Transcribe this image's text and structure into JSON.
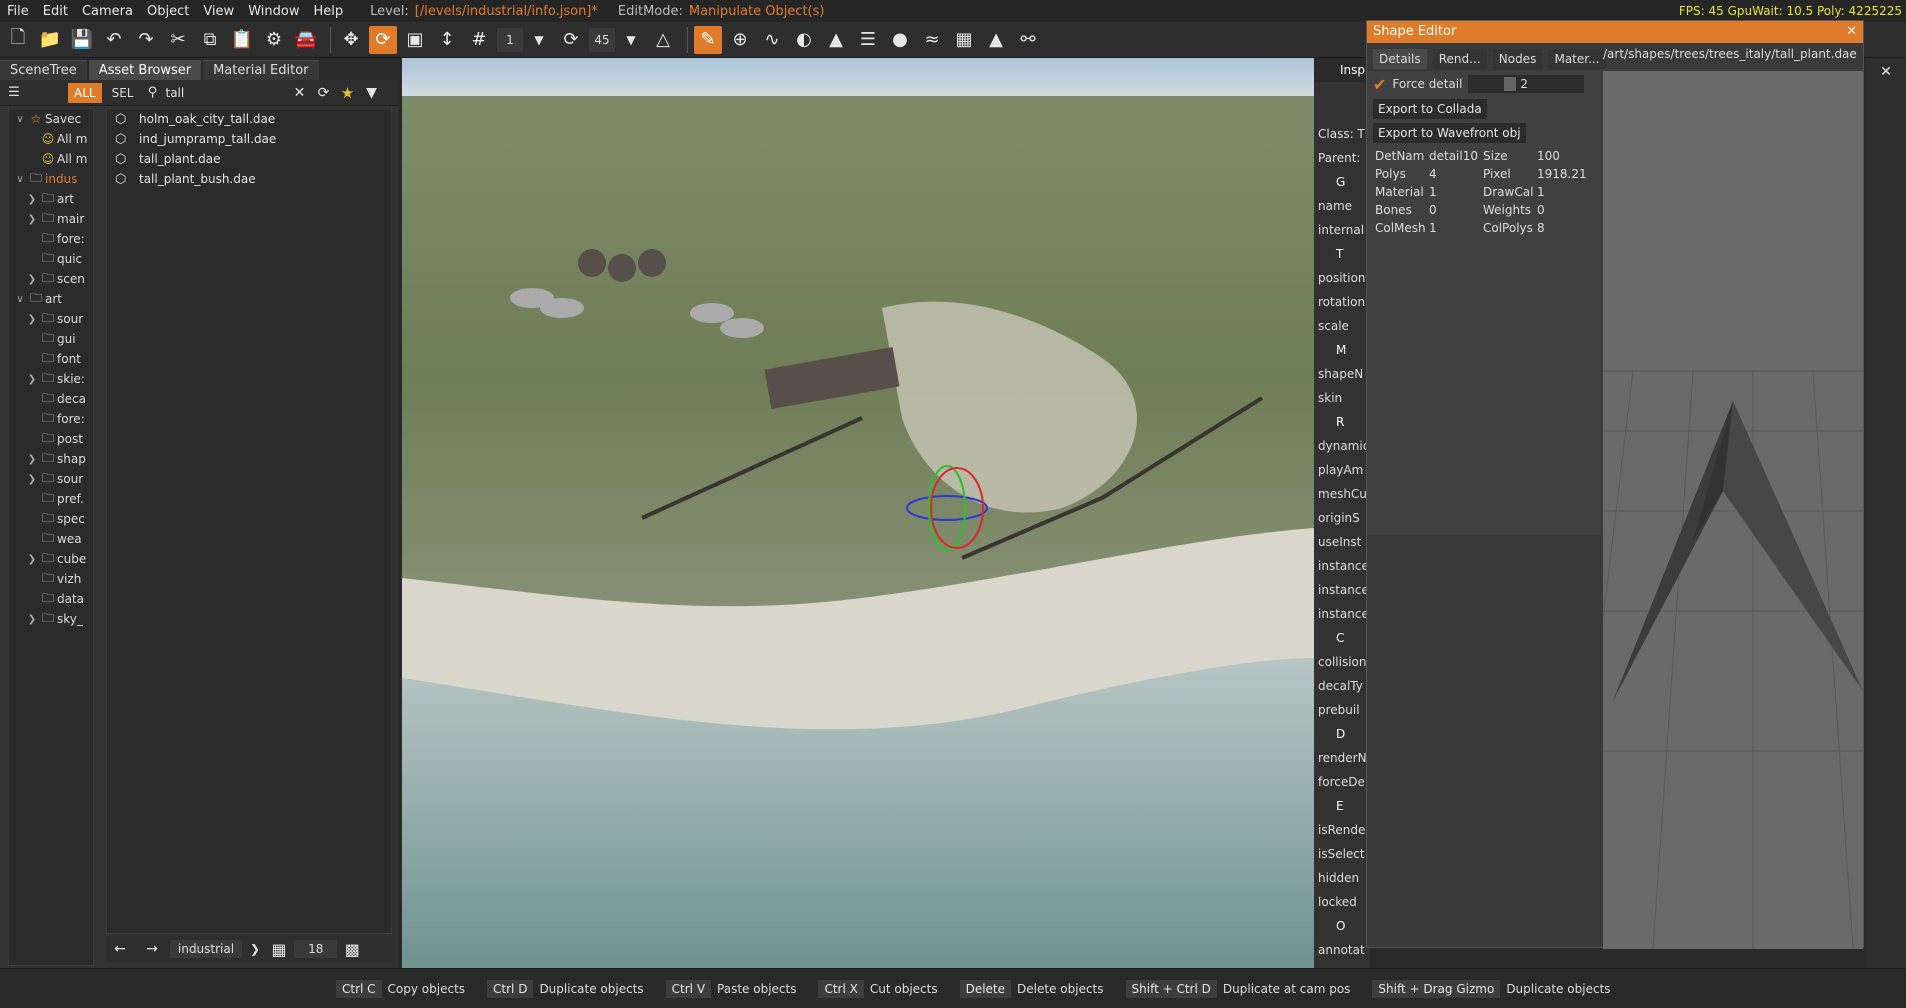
{
  "menu": {
    "items": [
      "File",
      "Edit",
      "Camera",
      "Object",
      "View",
      "Window",
      "Help"
    ],
    "level_label": "Level:",
    "level_value": "[/levels/industrial/info.json]*",
    "editmode_label": "EditMode:",
    "editmode_value": "Manipulate Object(s)",
    "perf": "FPS: 45  GpuWait: 10.5   Poly: 4225225"
  },
  "toolbar": {
    "snap_value": "1",
    "angle_value": "45"
  },
  "left_panel": {
    "tabs": [
      "SceneTree",
      "Asset Browser",
      "Material Editor"
    ],
    "filter_all": "ALL",
    "filter_sel": "SEL",
    "search_value": "tall",
    "tree": [
      {
        "label": "Savec",
        "indent": 0,
        "arrow": "v",
        "icon": "star"
      },
      {
        "label": "All m",
        "indent": 1,
        "arrow": "",
        "icon": "smile"
      },
      {
        "label": "All m",
        "indent": 1,
        "arrow": "",
        "icon": "smile"
      },
      {
        "label": "indus",
        "indent": 0,
        "arrow": "v",
        "icon": "folder",
        "hl": true
      },
      {
        "label": "art",
        "indent": 1,
        "arrow": ">",
        "icon": "folder"
      },
      {
        "label": "mair",
        "indent": 1,
        "arrow": ">",
        "icon": "folder"
      },
      {
        "label": "fore:",
        "indent": 1,
        "arrow": "",
        "icon": "folder"
      },
      {
        "label": "quic",
        "indent": 1,
        "arrow": "",
        "icon": "folder"
      },
      {
        "label": "scen",
        "indent": 1,
        "arrow": ">",
        "icon": "folder"
      },
      {
        "label": "art",
        "indent": 0,
        "arrow": "v",
        "icon": "folder"
      },
      {
        "label": "sour",
        "indent": 1,
        "arrow": ">",
        "icon": "folder"
      },
      {
        "label": "gui",
        "indent": 1,
        "arrow": "",
        "icon": "folder"
      },
      {
        "label": "font",
        "indent": 1,
        "arrow": "",
        "icon": "folder"
      },
      {
        "label": "skie:",
        "indent": 1,
        "arrow": ">",
        "icon": "folder"
      },
      {
        "label": "deca",
        "indent": 1,
        "arrow": "",
        "icon": "folder"
      },
      {
        "label": "fore:",
        "indent": 1,
        "arrow": "",
        "icon": "folder"
      },
      {
        "label": "post",
        "indent": 1,
        "arrow": "",
        "icon": "folder"
      },
      {
        "label": "shap",
        "indent": 1,
        "arrow": ">",
        "icon": "folder"
      },
      {
        "label": "sour",
        "indent": 1,
        "arrow": ">",
        "icon": "folder"
      },
      {
        "label": "pref.",
        "indent": 1,
        "arrow": "",
        "icon": "folder"
      },
      {
        "label": "spec",
        "indent": 1,
        "arrow": "",
        "icon": "folder"
      },
      {
        "label": "wea",
        "indent": 1,
        "arrow": "",
        "icon": "folder"
      },
      {
        "label": "cube",
        "indent": 1,
        "arrow": ">",
        "icon": "folder"
      },
      {
        "label": "vizh",
        "indent": 1,
        "arrow": "",
        "icon": "folder"
      },
      {
        "label": "data",
        "indent": 1,
        "arrow": "",
        "icon": "folder"
      },
      {
        "label": "sky_",
        "indent": 1,
        "arrow": ">",
        "icon": "folder"
      }
    ],
    "files": [
      "holm_oak_city_tall.dae",
      "ind_jumpramp_tall.dae",
      "tall_plant.dae",
      "tall_plant_bush.dae"
    ],
    "nav_path": "industrial",
    "nav_count": "18"
  },
  "inspector": {
    "title": "Insp",
    "rows": [
      "Class: T",
      "Parent:",
      "G",
      "name",
      "internal",
      "T",
      "position",
      "rotation",
      "scale",
      "M",
      "shapeN",
      "skin",
      "R",
      "dynamic",
      "playAm",
      "meshCu",
      "originS",
      "useInst",
      "instance",
      "instance",
      "instance",
      "C",
      "collision",
      "decalTy",
      "prebuil",
      "D",
      "renderN",
      "forceDe",
      "E",
      "isRende",
      "isSelect",
      "hidden",
      "locked",
      "O",
      "annotat"
    ],
    "headers": [
      "G",
      "T",
      "M",
      "R",
      "C",
      "D",
      "E",
      "O"
    ]
  },
  "shape_editor": {
    "title": "Shape Editor",
    "tabs": [
      "Details",
      "Rend...",
      "Nodes",
      "Mater..."
    ],
    "path": "/art/shapes/trees/trees_italy/tall_plant.dae",
    "force_detail_label": "Force detail",
    "force_detail_value": "2",
    "export_collada": "Export to Collada",
    "export_obj": "Export to Wavefront obj",
    "details": [
      [
        "DetNam",
        "detail10",
        "Size",
        "100"
      ],
      [
        "Polys",
        "4",
        "Pixel",
        "1918.21"
      ],
      [
        "Material",
        "1",
        "DrawCal",
        "1"
      ],
      [
        "Bones",
        "0",
        "Weights",
        "0"
      ],
      [
        "ColMesh",
        "1",
        "ColPolys",
        "8"
      ]
    ]
  },
  "statusbar": [
    {
      "key": "Ctrl C",
      "desc": "Copy objects"
    },
    {
      "key": "Ctrl D",
      "desc": "Duplicate objects"
    },
    {
      "key": "Ctrl V",
      "desc": "Paste objects"
    },
    {
      "key": "Ctrl X",
      "desc": "Cut objects"
    },
    {
      "key": "Delete",
      "desc": "Delete objects"
    },
    {
      "key": "Shift + Ctrl D",
      "desc": "Duplicate at cam pos"
    },
    {
      "key": "Shift + Drag Gizmo",
      "desc": "Duplicate objects"
    }
  ],
  "colors": {
    "accent": "#e07b2a",
    "perf": "#e6e62a"
  }
}
